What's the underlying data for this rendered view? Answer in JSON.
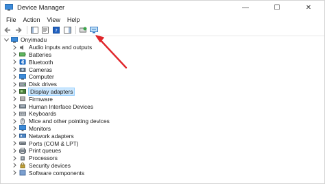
{
  "window": {
    "title": "Device Manager"
  },
  "menu": [
    "File",
    "Action",
    "View",
    "Help"
  ],
  "tree": {
    "root": "Onyimadu",
    "items": [
      {
        "label": "Audio inputs and outputs",
        "icon": "speaker-icon"
      },
      {
        "label": "Batteries",
        "icon": "battery-icon"
      },
      {
        "label": "Bluetooth",
        "icon": "bluetooth-icon"
      },
      {
        "label": "Cameras",
        "icon": "camera-icon"
      },
      {
        "label": "Computer",
        "icon": "computer-icon"
      },
      {
        "label": "Disk drives",
        "icon": "disk-drive-icon"
      },
      {
        "label": "Display adapters",
        "icon": "display-adapter-icon",
        "selected": true
      },
      {
        "label": "Firmware",
        "icon": "firmware-icon"
      },
      {
        "label": "Human Interface Devices",
        "icon": "hid-icon"
      },
      {
        "label": "Keyboards",
        "icon": "keyboard-icon"
      },
      {
        "label": "Mice and other pointing devices",
        "icon": "mouse-icon"
      },
      {
        "label": "Monitors",
        "icon": "monitor-icon"
      },
      {
        "label": "Network adapters",
        "icon": "network-adapter-icon"
      },
      {
        "label": "Ports (COM & LPT)",
        "icon": "port-icon"
      },
      {
        "label": "Print queues",
        "icon": "printer-icon"
      },
      {
        "label": "Processors",
        "icon": "processor-icon"
      },
      {
        "label": "Security devices",
        "icon": "security-device-icon"
      },
      {
        "label": "Software components",
        "icon": "software-component-icon"
      }
    ]
  },
  "colors": {
    "arrow": "#e0262b",
    "selection": "#cce8ff",
    "accent": "#0a64c8"
  }
}
